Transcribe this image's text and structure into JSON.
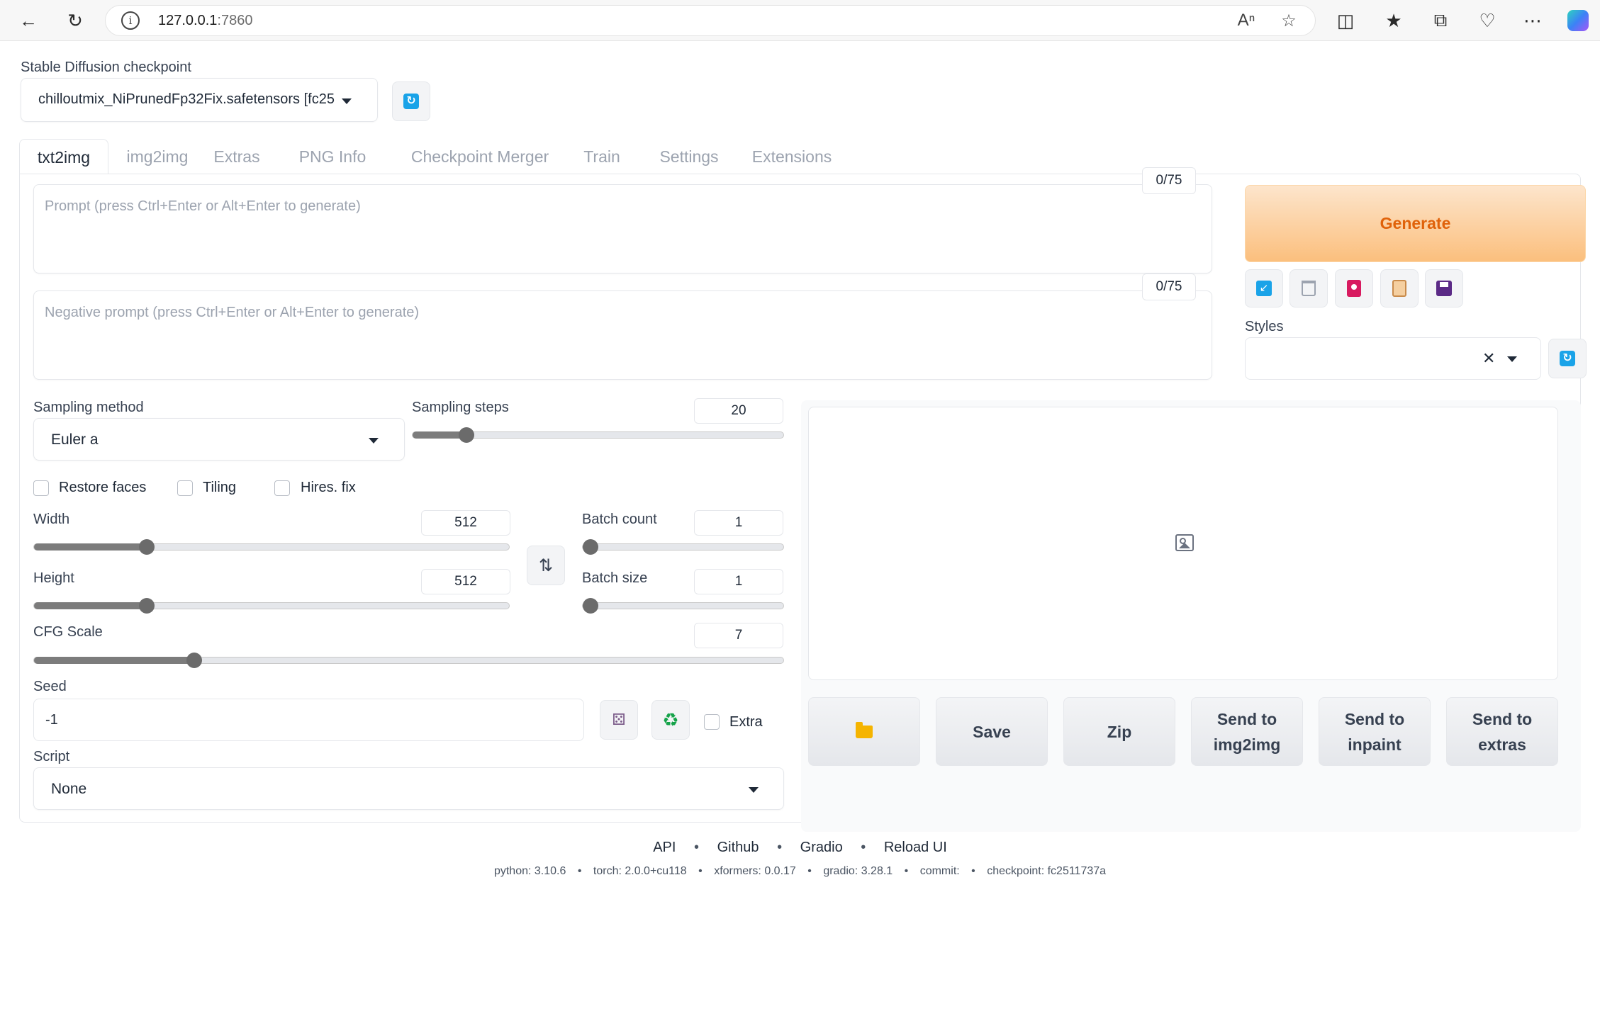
{
  "browser": {
    "url_host": "127.0.0.1",
    "url_port": ":7860"
  },
  "checkpoint": {
    "label": "Stable Diffusion checkpoint",
    "value": "chilloutmix_NiPrunedFp32Fix.safetensors [fc25"
  },
  "tabs": [
    {
      "label": "txt2img",
      "active": true
    },
    {
      "label": "img2img"
    },
    {
      "label": "Extras"
    },
    {
      "label": "PNG Info"
    },
    {
      "label": "Checkpoint Merger"
    },
    {
      "label": "Train"
    },
    {
      "label": "Settings"
    },
    {
      "label": "Extensions"
    }
  ],
  "prompt": {
    "placeholder": "Prompt (press Ctrl+Enter or Alt+Enter to generate)",
    "counter": "0/75"
  },
  "negative_prompt": {
    "placeholder": "Negative prompt (press Ctrl+Enter or Alt+Enter to generate)",
    "counter": "0/75"
  },
  "generate_label": "Generate",
  "styles_label": "Styles",
  "sampling": {
    "method_label": "Sampling method",
    "method_value": "Euler a",
    "steps_label": "Sampling steps",
    "steps_value": "20"
  },
  "checkboxes": {
    "restore_faces": "Restore faces",
    "tiling": "Tiling",
    "hires_fix": "Hires. fix",
    "extra": "Extra"
  },
  "width": {
    "label": "Width",
    "value": "512"
  },
  "height": {
    "label": "Height",
    "value": "512"
  },
  "batch_count": {
    "label": "Batch count",
    "value": "1"
  },
  "batch_size": {
    "label": "Batch size",
    "value": "1"
  },
  "cfg_scale": {
    "label": "CFG Scale",
    "value": "7"
  },
  "seed": {
    "label": "Seed",
    "value": "-1"
  },
  "script": {
    "label": "Script",
    "value": "None"
  },
  "output_buttons": {
    "save": "Save",
    "zip": "Zip",
    "send_img2img_1": "Send to",
    "send_img2img_2": "img2img",
    "send_inpaint_1": "Send to",
    "send_inpaint_2": "inpaint",
    "send_extras_1": "Send to",
    "send_extras_2": "extras"
  },
  "footer": {
    "links": [
      "API",
      "Github",
      "Gradio",
      "Reload UI"
    ],
    "bullet": "•",
    "meta": [
      "python: 3.10.6",
      "torch: 2.0.0+cu118",
      "xformers: 0.0.17",
      "gradio: 3.28.1",
      "commit:",
      "checkpoint: fc2511737a"
    ]
  },
  "colors": {
    "generate_text": "#e0620a",
    "accent_blue": "#1aa3e8",
    "slider_fill": "#7c7c7c"
  }
}
